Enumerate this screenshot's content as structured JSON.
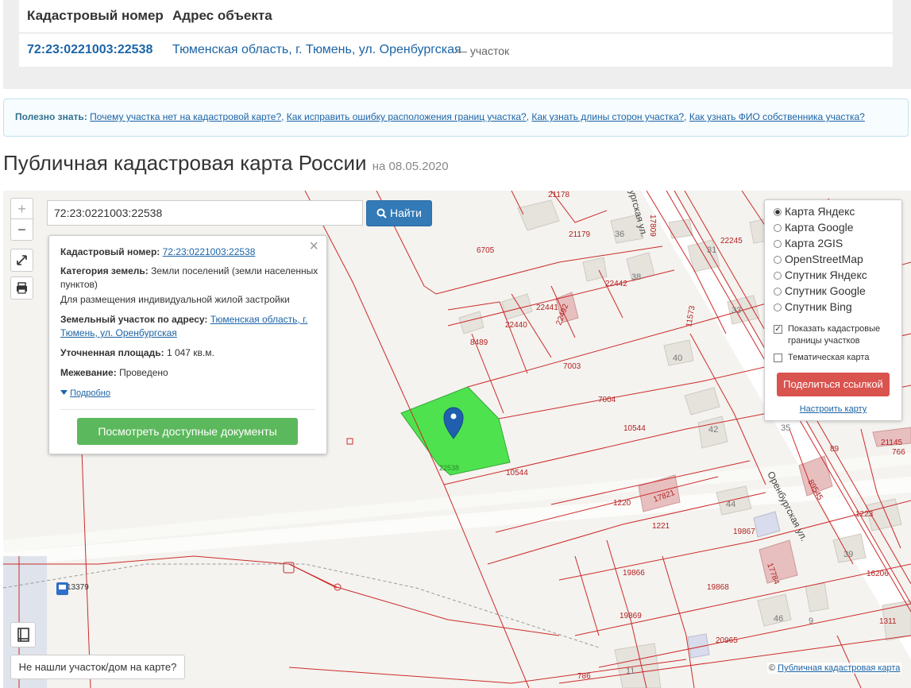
{
  "table": {
    "col_number": "Кадастровый номер",
    "col_address": "Адрес объекта",
    "row": {
      "number": "72:23:0221003:22538",
      "address": "Тюменская область, г. Тюмень, ул. Оренбургская",
      "suffix": "— участок"
    }
  },
  "info": {
    "label": "Полезно знать:",
    "links": [
      "Почему участка нет на кадастровой карте?",
      "Как исправить ошибку расположения границ участка?",
      "Как узнать длины сторон участка?",
      "Как узнать ФИО собственника участка?"
    ]
  },
  "page": {
    "title": "Публичная кадастровая карта России",
    "date": "на 08.05.2020"
  },
  "map": {
    "zoom_in": "+",
    "zoom_out": "−",
    "search_value": "72:23:0221003:22538",
    "find_button": "Найти",
    "not_found": "Не нашли участок/дом на карте?",
    "attribution_prefix": "©",
    "attribution_link": "Публичная кадастровая карта",
    "parcel_labels": [
      "21178",
      "21179",
      "36",
      "6705",
      "17809",
      "22245",
      "31",
      "38",
      "22442",
      "33",
      "22441",
      "22492",
      "22440",
      "8489",
      "11573",
      "7003",
      "40",
      "7004",
      "10544",
      "42",
      "22538",
      "10544",
      "35",
      "21145",
      "89",
      "766",
      "1220",
      "1221",
      "17821",
      "44",
      "19867",
      "1223",
      "19866",
      "39",
      "16206",
      "19868",
      "19869",
      "46",
      "9",
      "1311",
      "20965",
      "786",
      "11",
      "13379",
      "89545",
      "17784"
    ],
    "street_labels": [
      "Оренбургская ул.",
      "ургская ул."
    ]
  },
  "popup": {
    "close": "×",
    "cad_label": "Кадастровый номер:",
    "cad_value": "72:23:0221003:22538",
    "category_label": "Категория земель:",
    "category_value": "Земли поселений (земли населенных пунктов)",
    "usage": "Для размещения индивидуальной жилой застройки",
    "address_label": "Земельный участок по адресу:",
    "address_value": "Тюменская область, г. Тюмень, ул. Оренбургская",
    "area_label": "Уточненная площадь:",
    "area_value": "1 047 кв.м.",
    "survey_label": "Межевание:",
    "survey_value": "Проведено",
    "details_link": "Подробно",
    "docs_button": "Посмотреть доступные документы"
  },
  "layers": {
    "options": [
      "Карта Яндекс",
      "Карта Google",
      "Карта 2GIS",
      "OpenStreetMap",
      "Спутник Яндекс",
      "Спутник Google",
      "Спутник Bing"
    ],
    "selected": "Карта Яндекс",
    "show_borders": "Показать кадастровые границы участков",
    "show_borders_checked": true,
    "thematic": "Тематическая карта",
    "thematic_checked": false,
    "share_button": "Поделиться ссылкой",
    "settings_link": "Настроить карту"
  },
  "colors": {
    "boundary": "#cc2b2b",
    "selected_parcel": "#4ee34e",
    "primary": "#337ab7",
    "success": "#5cb85c",
    "danger": "#d9534f"
  }
}
